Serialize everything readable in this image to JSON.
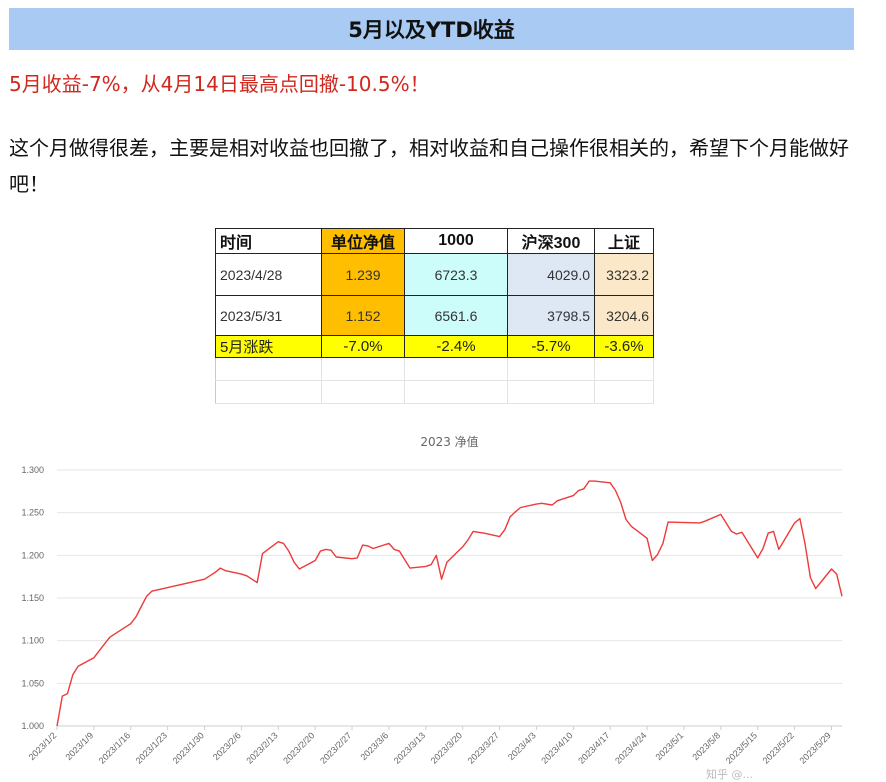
{
  "banner": {
    "title": "5月以及YTD收益"
  },
  "summary": {
    "headline": "5月收益-7%，从4月14日最高点回撤-10.5%！"
  },
  "commentary": {
    "text": "这个月做得很差，主要是相对收益也回撤了，相对收益和自己操作很相关的，希望下个月能做好吧！"
  },
  "colors": {
    "banner": "#a9cbf3",
    "headline": "#d0281f",
    "nav_col": "#ffbf00",
    "idx1000_col": "#ccfdfb",
    "hs300_col": "#dde8f4",
    "sz_col": "#fbe8c8",
    "change_row": "#ffff00",
    "line": "#ee3a3a"
  },
  "table": {
    "headers": [
      "时间",
      "单位净值",
      "1000",
      "沪深300",
      "上证"
    ],
    "rows": [
      [
        "2023/4/28",
        "1.239",
        "6723.3",
        "4029.0",
        "3323.2"
      ],
      [
        "2023/5/31",
        "1.152",
        "6561.6",
        "3798.5",
        "3204.6"
      ]
    ],
    "change_row": [
      "5月涨跌",
      "-7.0%",
      "-2.4%",
      "-5.7%",
      "-3.6%"
    ]
  },
  "chart_data": {
    "type": "line",
    "title": "2023 净值",
    "xlabel": "",
    "ylabel": "",
    "ylim": [
      1.0,
      1.3
    ],
    "y_ticks": [
      "1.000",
      "1.050",
      "1.100",
      "1.150",
      "1.200",
      "1.250",
      "1.300"
    ],
    "x_ticks": [
      "2023/1/2",
      "2023/1/9",
      "2023/1/16",
      "2023/1/23",
      "2023/1/30",
      "2023/2/6",
      "2023/2/13",
      "2023/2/20",
      "2023/2/27",
      "2023/3/6",
      "2023/3/13",
      "2023/3/20",
      "2023/3/27",
      "2023/4/3",
      "2023/4/10",
      "2023/4/17",
      "2023/4/24",
      "2023/5/1",
      "2023/5/8",
      "2023/5/15",
      "2023/5/22",
      "2023/5/29"
    ],
    "grid": true,
    "legend": "none",
    "series": [
      {
        "x": [
          "2023/1/2",
          "2023/1/3",
          "2023/1/4",
          "2023/1/5",
          "2023/1/6",
          "2023/1/9",
          "2023/1/10",
          "2023/1/11",
          "2023/1/12",
          "2023/1/13",
          "2023/1/16",
          "2023/1/17",
          "2023/1/18",
          "2023/1/19",
          "2023/1/20",
          "2023/1/30",
          "2023/1/31",
          "2023/2/1",
          "2023/2/2",
          "2023/2/3",
          "2023/2/6",
          "2023/2/7",
          "2023/2/8",
          "2023/2/9",
          "2023/2/10",
          "2023/2/13",
          "2023/2/14",
          "2023/2/15",
          "2023/2/16",
          "2023/2/17",
          "2023/2/20",
          "2023/2/21",
          "2023/2/22",
          "2023/2/23",
          "2023/2/24",
          "2023/2/27",
          "2023/2/28",
          "2023/3/1",
          "2023/3/2",
          "2023/3/3",
          "2023/3/6",
          "2023/3/7",
          "2023/3/8",
          "2023/3/9",
          "2023/3/10",
          "2023/3/13",
          "2023/3/14",
          "2023/3/15",
          "2023/3/16",
          "2023/3/17",
          "2023/3/20",
          "2023/3/21",
          "2023/3/22",
          "2023/3/23",
          "2023/3/24",
          "2023/3/27",
          "2023/3/28",
          "2023/3/29",
          "2023/3/30",
          "2023/3/31",
          "2023/4/3",
          "2023/4/4",
          "2023/4/6",
          "2023/4/7",
          "2023/4/10",
          "2023/4/11",
          "2023/4/12",
          "2023/4/13",
          "2023/4/14",
          "2023/4/17",
          "2023/4/18",
          "2023/4/19",
          "2023/4/20",
          "2023/4/21",
          "2023/4/24",
          "2023/4/25",
          "2023/4/26",
          "2023/4/27",
          "2023/4/28",
          "2023/5/4",
          "2023/5/5",
          "2023/5/8",
          "2023/5/9",
          "2023/5/10",
          "2023/5/11",
          "2023/5/12",
          "2023/5/15",
          "2023/5/16",
          "2023/5/17",
          "2023/5/18",
          "2023/5/19",
          "2023/5/22",
          "2023/5/23",
          "2023/5/24",
          "2023/5/25",
          "2023/5/26",
          "2023/5/29",
          "2023/5/30",
          "2023/5/31"
        ],
        "values": [
          1.0,
          1.035,
          1.038,
          1.06,
          1.07,
          1.08,
          1.088,
          1.096,
          1.104,
          1.108,
          1.12,
          1.128,
          1.14,
          1.152,
          1.158,
          1.172,
          1.176,
          1.18,
          1.185,
          1.182,
          1.178,
          1.176,
          1.172,
          1.168,
          1.202,
          1.216,
          1.214,
          1.205,
          1.192,
          1.184,
          1.194,
          1.205,
          1.207,
          1.206,
          1.198,
          1.196,
          1.197,
          1.212,
          1.211,
          1.208,
          1.214,
          1.207,
          1.205,
          1.195,
          1.185,
          1.187,
          1.189,
          1.2,
          1.172,
          1.192,
          1.21,
          1.218,
          1.228,
          1.227,
          1.226,
          1.222,
          1.23,
          1.245,
          1.251,
          1.256,
          1.26,
          1.261,
          1.259,
          1.264,
          1.27,
          1.276,
          1.278,
          1.287,
          1.287,
          1.285,
          1.276,
          1.262,
          1.242,
          1.234,
          1.22,
          1.194,
          1.201,
          1.214,
          1.239,
          1.238,
          1.24,
          1.248,
          1.238,
          1.228,
          1.225,
          1.227,
          1.197,
          1.208,
          1.226,
          1.228,
          1.207,
          1.238,
          1.243,
          1.213,
          1.174,
          1.161,
          1.184,
          1.178,
          1.152
        ]
      }
    ]
  },
  "watermark": {
    "text": "知乎 @..."
  }
}
